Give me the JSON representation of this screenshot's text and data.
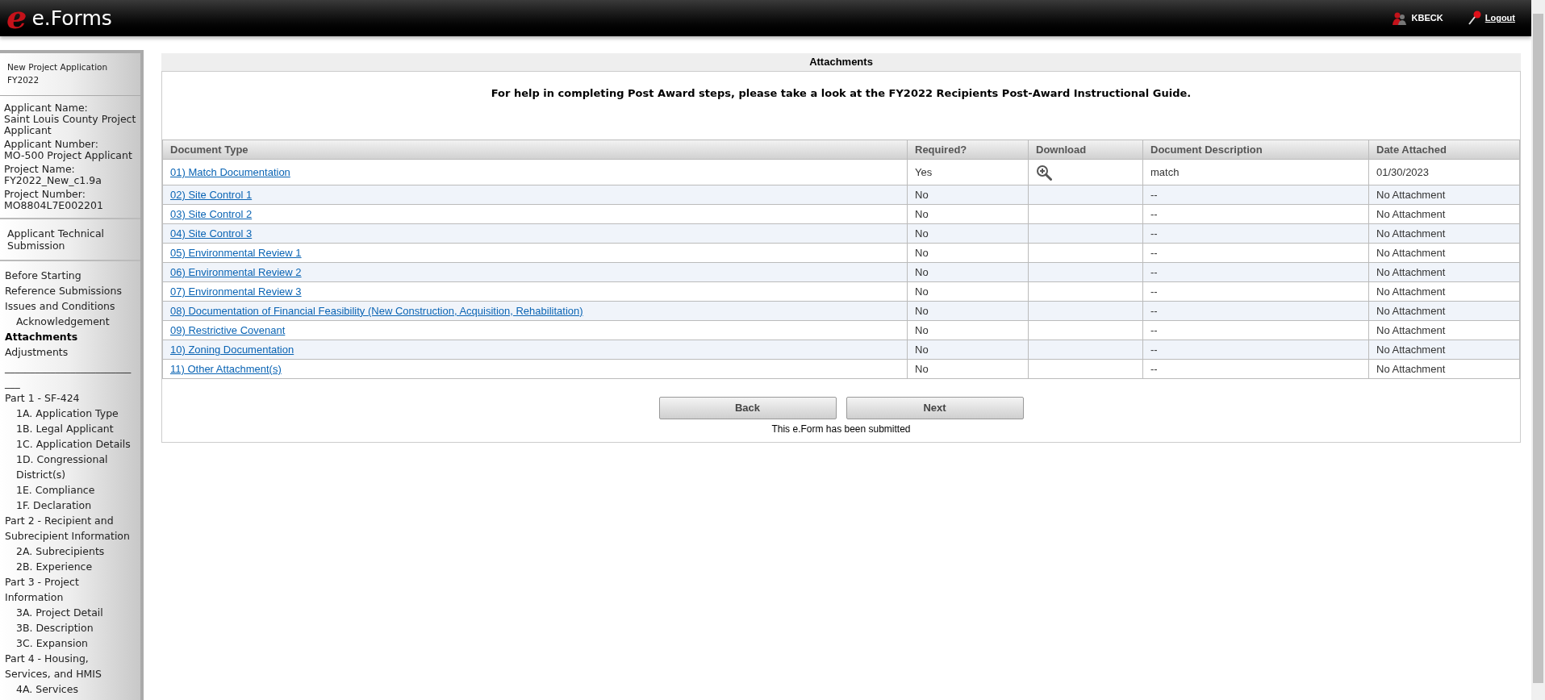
{
  "header": {
    "logo_letter": "e",
    "logo_text": "e.Forms",
    "user": "KBECK",
    "logout": "Logout"
  },
  "sidebar": {
    "application": "New Project Application FY2022",
    "fields": [
      {
        "label": "Applicant Name:",
        "value": "Saint Louis County Project Applicant"
      },
      {
        "label": "Applicant Number:",
        "value": "MO-500 Project Applicant"
      },
      {
        "label": "Project Name:",
        "value": "FY2022_New_c1.9a"
      },
      {
        "label": "Project Number:",
        "value": "MO8804L7E002201"
      }
    ],
    "section": "Applicant Technical Submission",
    "nav": [
      {
        "label": "Before Starting",
        "selected": false
      },
      {
        "label": "Reference Submissions",
        "selected": false
      },
      {
        "label": "Issues and Conditions",
        "selected": false,
        "children": [
          {
            "label": "Acknowledgement",
            "selected": false
          }
        ]
      },
      {
        "label": "Attachments",
        "selected": true
      },
      {
        "label": "Adjustments",
        "selected": false
      },
      {
        "label": "____________________________",
        "selected": false
      },
      {
        "label": "Part 1 - SF-424",
        "selected": false,
        "children": [
          {
            "label": "1A. Application Type",
            "selected": false
          },
          {
            "label": "1B. Legal Applicant",
            "selected": false
          },
          {
            "label": "1C. Application Details",
            "selected": false
          },
          {
            "label": "1D. Congressional District(s)",
            "selected": false
          },
          {
            "label": "1E. Compliance",
            "selected": false
          },
          {
            "label": "1F. Declaration",
            "selected": false
          }
        ]
      },
      {
        "label": "Part 2 - Recipient and Subrecipient Information",
        "selected": false,
        "children": [
          {
            "label": "2A. Subrecipients",
            "selected": false
          },
          {
            "label": "2B. Experience",
            "selected": false
          }
        ]
      },
      {
        "label": "Part 3 - Project Information",
        "selected": false,
        "children": [
          {
            "label": "3A. Project Detail",
            "selected": false
          },
          {
            "label": "3B. Description",
            "selected": false
          },
          {
            "label": "3C. Expansion",
            "selected": false
          }
        ]
      },
      {
        "label": "Part 4 - Housing, Services, and HMIS",
        "selected": false,
        "children": [
          {
            "label": "4A. Services",
            "selected": false
          }
        ]
      }
    ]
  },
  "main": {
    "title": "Attachments",
    "help": "For help in completing Post Award steps, please take a look at the FY2022 Recipients Post-Award Instructional Guide.",
    "table": {
      "columns": [
        "Document Type",
        "Required?",
        "Download",
        "Document Description",
        "Date Attached"
      ],
      "rows": [
        {
          "document": "01) Match Documentation",
          "required": "Yes",
          "download": true,
          "description": "match",
          "date": "01/30/2023"
        },
        {
          "document": "02) Site Control 1",
          "required": "No",
          "download": false,
          "description": "--",
          "date": "No Attachment"
        },
        {
          "document": "03) Site Control 2",
          "required": "No",
          "download": false,
          "description": "--",
          "date": "No Attachment"
        },
        {
          "document": "04) Site Control 3",
          "required": "No",
          "download": false,
          "description": "--",
          "date": "No Attachment"
        },
        {
          "document": "05) Environmental Review 1",
          "required": "No",
          "download": false,
          "description": "--",
          "date": "No Attachment"
        },
        {
          "document": "06) Environmental Review 2",
          "required": "No",
          "download": false,
          "description": "--",
          "date": "No Attachment"
        },
        {
          "document": "07) Environmental Review 3",
          "required": "No",
          "download": false,
          "description": "--",
          "date": "No Attachment"
        },
        {
          "document": "08) Documentation of Financial Feasibility (New Construction, Acquisition, Rehabilitation)",
          "required": "No",
          "download": false,
          "description": "--",
          "date": "No Attachment"
        },
        {
          "document": "09) Restrictive Covenant",
          "required": "No",
          "download": false,
          "description": "--",
          "date": "No Attachment"
        },
        {
          "document": "10) Zoning Documentation",
          "required": "No",
          "download": false,
          "description": "--",
          "date": "No Attachment"
        },
        {
          "document": "11) Other Attachment(s)",
          "required": "No",
          "download": false,
          "description": "--",
          "date": "No Attachment"
        }
      ]
    },
    "buttons": [
      "Back",
      "Next"
    ],
    "status": "This e.Form has been submitted"
  }
}
